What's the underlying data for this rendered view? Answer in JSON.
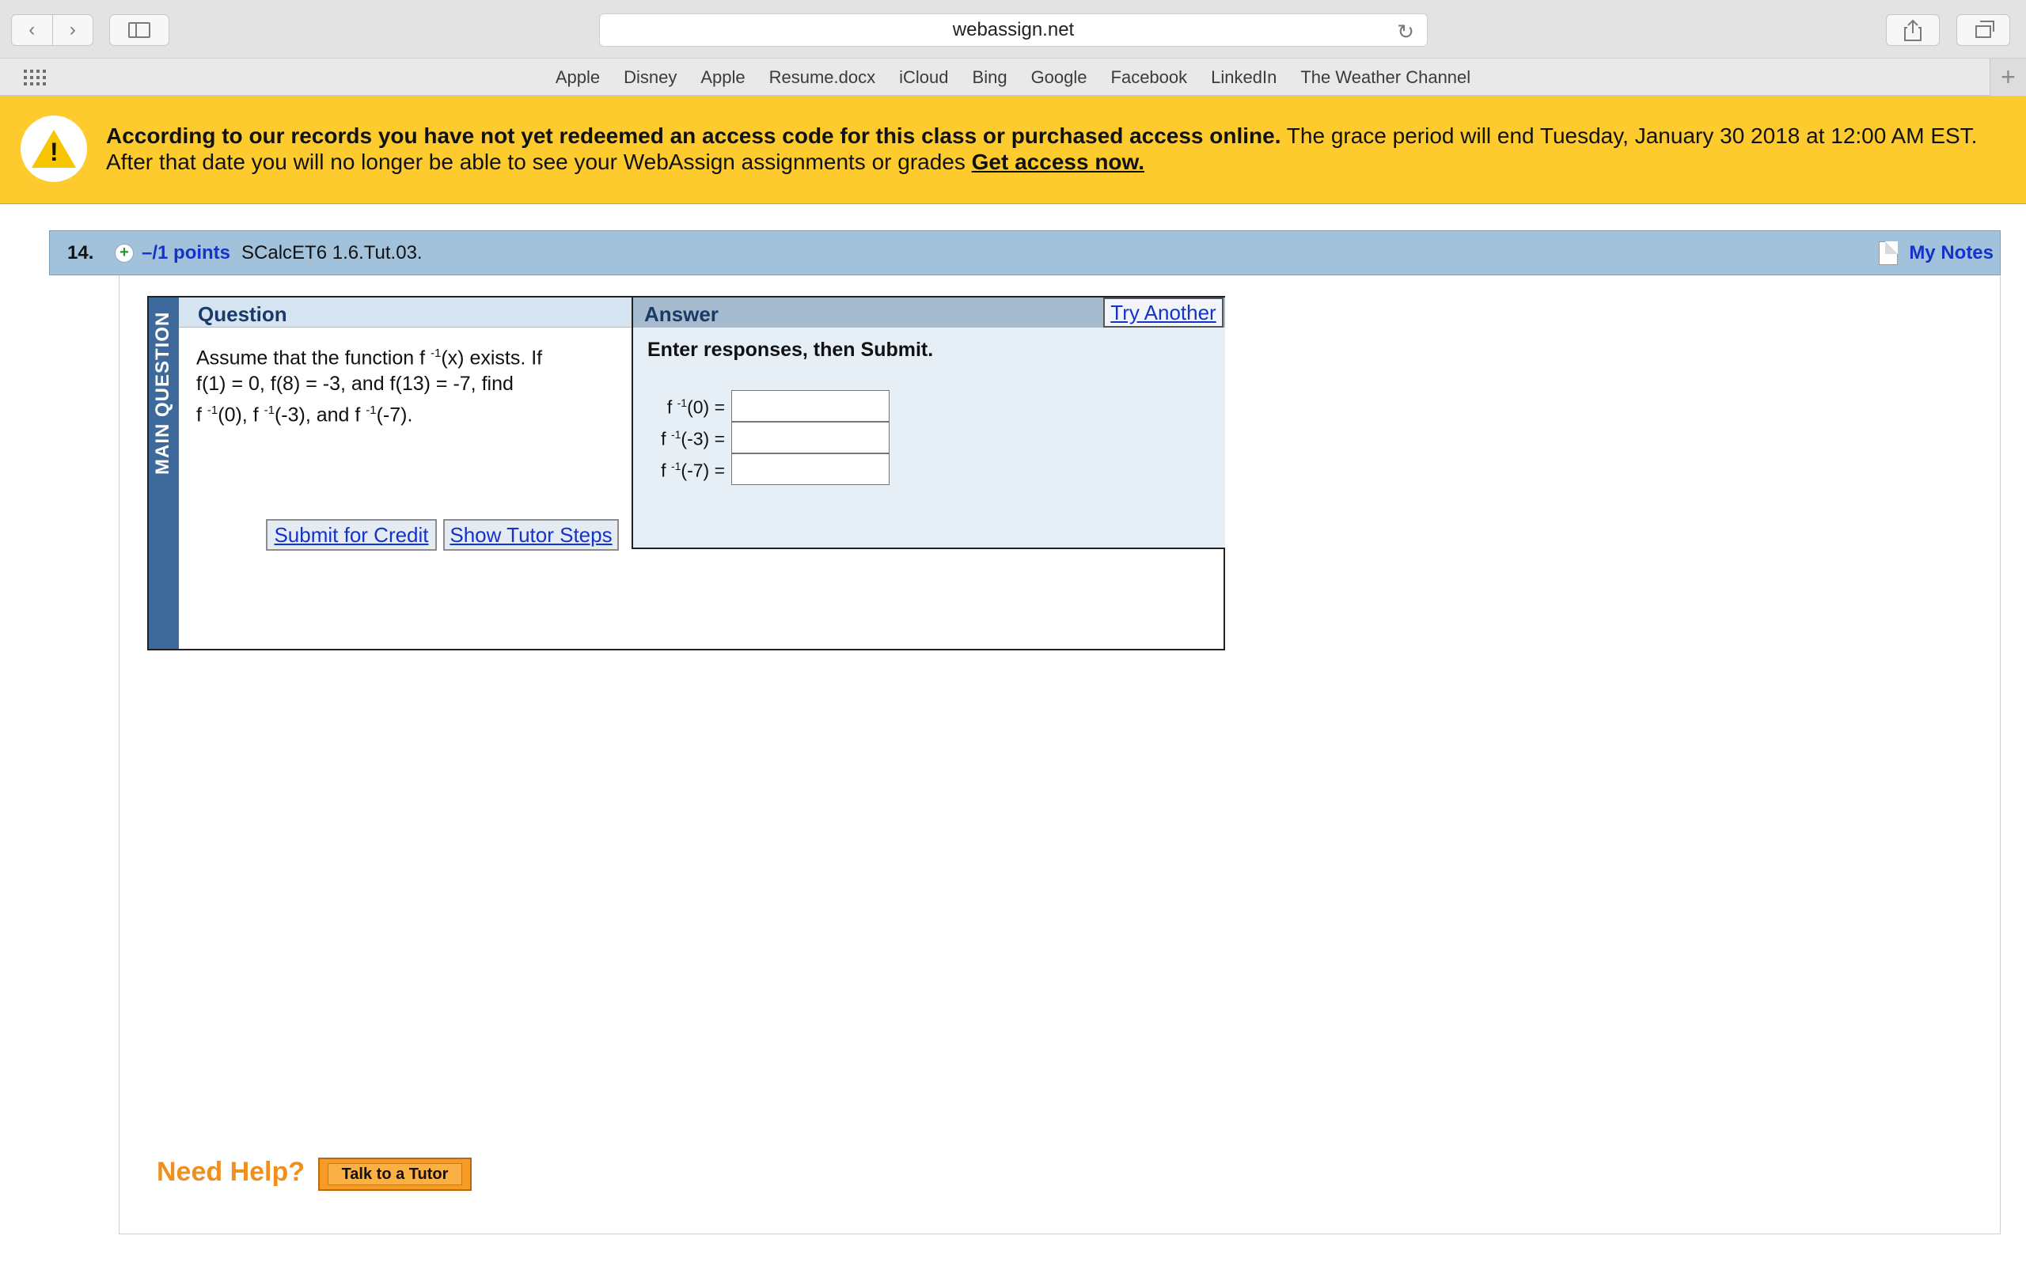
{
  "browser": {
    "url": "webassign.net",
    "back_glyph": "‹",
    "forward_glyph": "›",
    "reload_glyph": "↻",
    "share_glyph": "⇪",
    "favorites": [
      "Apple",
      "Disney",
      "Apple",
      "Resume.docx",
      "iCloud",
      "Bing",
      "Google",
      "Facebook",
      "LinkedIn",
      "The Weather Channel"
    ],
    "add_glyph": "+"
  },
  "banner": {
    "bang": "!",
    "bold_text": "According to our records you have not yet redeemed an access code for this class or purchased access online.",
    "rest_text": " The grace period will end Tuesday, January 30 2018 at 12:00 AM EST.",
    "line2": "After that date you will no longer be able to see your WebAssign assignments or grades ",
    "link": "Get access now."
  },
  "question": {
    "number": "14.",
    "plus": "+",
    "points": "–/1 points",
    "id": "SCalcET6 1.6.Tut.03.",
    "my_notes": "My Notes",
    "side_label": "MAIN QUESTION",
    "header": "Question",
    "text": {
      "p1": "Assume that the function f ",
      "sup": "-1",
      "p2": "(x) exists. If",
      "line2": "f(1) = 0, f(8) = -3, and f(13) = -7, find",
      "f0": "(0), f ",
      "f1": "(-3), and f ",
      "f2": "(-7)."
    },
    "submit_label": "Submit for Credit",
    "tutor_steps_label": "Show Tutor Steps"
  },
  "answer": {
    "header": "Answer",
    "try_another": "Try Another",
    "instructions": "Enter responses, then Submit.",
    "fn": "f ",
    "sup": "-1",
    "rows": [
      {
        "arg": "(0) =",
        "value": ""
      },
      {
        "arg": "(-3) =",
        "value": ""
      },
      {
        "arg": "(-7) =",
        "value": ""
      }
    ]
  },
  "help": {
    "need_help": "Need Help?",
    "talk_to_tutor": "Talk to a Tutor"
  },
  "colors": {
    "banner": "#fdcb2d",
    "header_strip": "#a2c2db",
    "side_bar": "#3d6a9a",
    "link_blue": "#1433c8",
    "help_orange": "#ef8f1d"
  }
}
